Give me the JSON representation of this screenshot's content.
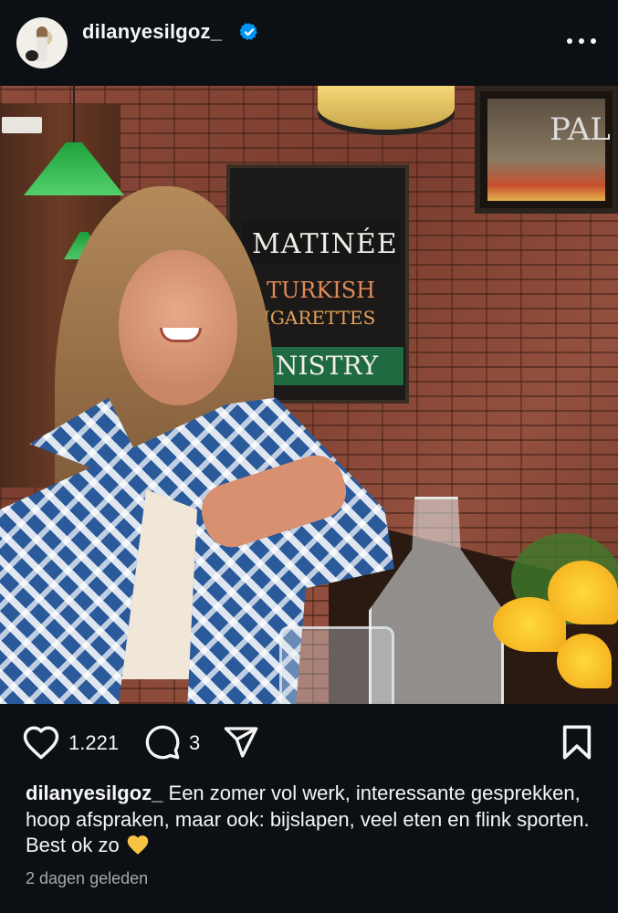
{
  "header": {
    "username": "dilanyesilgoz_",
    "verified": true,
    "verified_icon": "verified-badge-icon",
    "more_icon": "more-options-icon"
  },
  "post_image": {
    "description_icon": "post-photo"
  },
  "sign_text": {
    "line1": "MATINÉE",
    "line2": "TURKISH",
    "line3": "IGARETTES",
    "line4": "NISTRY",
    "frame": "PAL"
  },
  "actions": {
    "like_icon": "heart-icon",
    "likes": "1.221",
    "comment_icon": "comment-icon",
    "comments": "3",
    "share_icon": "send-icon",
    "save_icon": "bookmark-icon"
  },
  "caption": {
    "username": "dilanyesilgoz_",
    "text": "Een zomer vol werk, interessante gesprekken, hoop afspraken, maar ook: bijslapen, veel eten en flink sporten. Best ok zo",
    "emoji_icon": "yellow-heart-icon"
  },
  "timestamp": "2 dagen geleden",
  "colors": {
    "background": "#0c1014",
    "text": "#f5f5f5",
    "muted": "#a8a8a8",
    "verified": "#0095f6",
    "emoji": "#f6c343"
  }
}
